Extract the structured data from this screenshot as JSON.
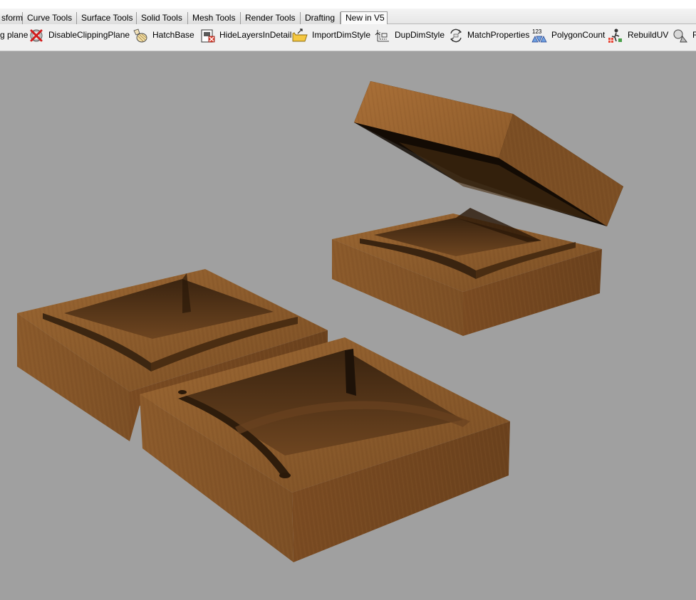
{
  "tabs": [
    "sform",
    "Curve Tools",
    "Surface Tools",
    "Solid Tools",
    "Mesh Tools",
    "Render Tools",
    "Drafting",
    "New in V5"
  ],
  "active_tab": "New in V5",
  "toolbar": {
    "items": [
      {
        "label": "g plane",
        "icon": "clipping-plane-icon"
      },
      {
        "label": "DisableClippingPlane",
        "icon": "disable-clipping-plane-icon"
      },
      {
        "label": "HatchBase",
        "icon": "hatch-base-icon"
      },
      {
        "label": "HideLayersInDetail",
        "icon": "hide-layers-in-detail-icon"
      },
      {
        "label": "ImportDimStyle",
        "icon": "import-dim-style-icon"
      },
      {
        "label": "DupDimStyle",
        "icon": "dup-dim-style-icon"
      },
      {
        "label": "MatchProperties",
        "icon": "match-properties-icon"
      },
      {
        "label": "PolygonCount",
        "icon": "polygon-count-icon"
      },
      {
        "label": "RebuildUV",
        "icon": "rebuild-uv-icon"
      },
      {
        "label": "R",
        "icon": "next-command-icon"
      }
    ],
    "polygon_count_icon_text": "123"
  },
  "viewport": {
    "background": "#a0a0a0",
    "wood_colors": [
      "#8b5a2b",
      "#6b4220",
      "#a06a35",
      "#3b2410"
    ]
  }
}
